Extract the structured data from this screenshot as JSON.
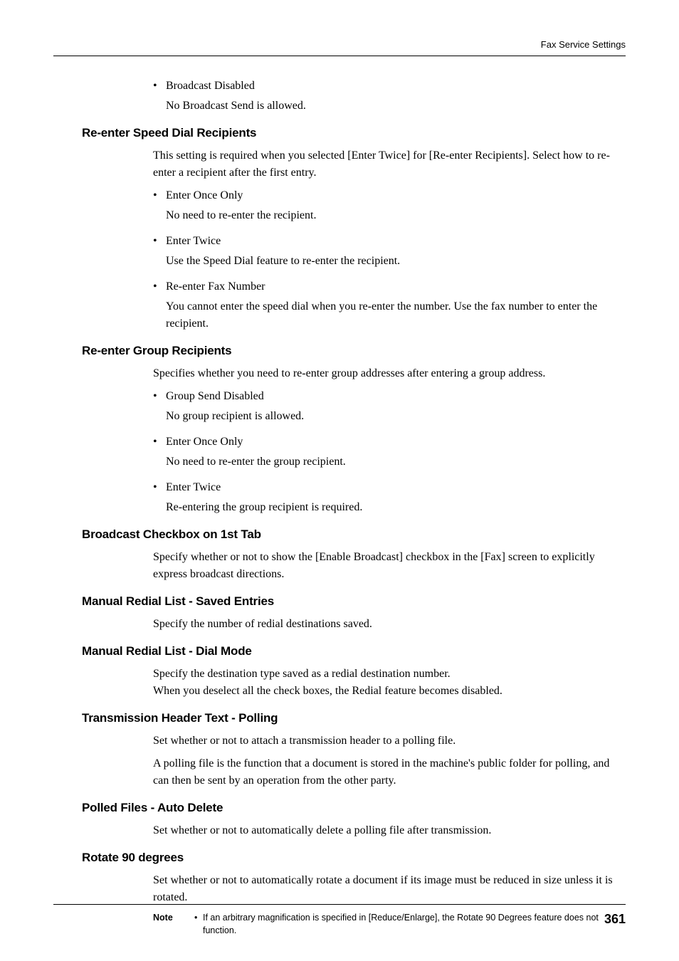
{
  "header": {
    "section_title": "Fax Service Settings"
  },
  "intro_bullet": {
    "label": "Broadcast Disabled",
    "desc": "No Broadcast Send is allowed."
  },
  "sections": {
    "s1": {
      "title": "Re-enter Speed Dial Recipients",
      "intro": "This setting is required when you selected [Enter Twice] for [Re-enter Recipients]. Select how to re-enter a recipient after the first entry.",
      "b1": {
        "label": "Enter Once Only",
        "desc": "No need to re-enter the recipient."
      },
      "b2": {
        "label": "Enter Twice",
        "desc": "Use the Speed Dial feature to re-enter the recipient."
      },
      "b3": {
        "label": "Re-enter Fax Number",
        "desc": "You cannot enter the speed dial when you re-enter the number. Use the fax number to enter the recipient."
      }
    },
    "s2": {
      "title": "Re-enter Group Recipients",
      "intro": "Specifies whether you need to re-enter group addresses after entering a group address.",
      "b1": {
        "label": "Group Send Disabled",
        "desc": "No group recipient is allowed."
      },
      "b2": {
        "label": "Enter Once Only",
        "desc": "No need to re-enter the group recipient."
      },
      "b3": {
        "label": "Enter Twice",
        "desc": "Re-entering the group recipient is required."
      }
    },
    "s3": {
      "title": "Broadcast Checkbox on 1st Tab",
      "intro": "Specify whether or not to show the [Enable Broadcast] checkbox in the [Fax] screen to explicitly express broadcast directions."
    },
    "s4": {
      "title": "Manual Redial List - Saved Entries",
      "intro": "Specify the number of redial destinations saved."
    },
    "s5": {
      "title": "Manual Redial List - Dial Mode",
      "intro": "Specify the destination type saved as a redial destination number.\nWhen you deselect all the check boxes, the Redial feature becomes disabled."
    },
    "s6": {
      "title": "Transmission Header Text - Polling",
      "intro1": "Set whether or not to attach a transmission header to a polling file.",
      "intro2": "A polling file is the function that a document is stored in the machine's public folder for polling, and can then be sent by an operation from the other party."
    },
    "s7": {
      "title": "Polled Files - Auto Delete",
      "intro": "Set whether or not to automatically delete a polling file after transmission."
    },
    "s8": {
      "title": "Rotate 90 degrees",
      "intro": "Set whether or not to automatically rotate a document if its image must be reduced in size unless it is rotated.",
      "note_label": "Note",
      "note_text": "If an arbitrary magnification is specified in [Reduce/Enlarge], the Rotate 90 Degrees feature does not function."
    }
  },
  "footer": {
    "page_number": "361"
  }
}
